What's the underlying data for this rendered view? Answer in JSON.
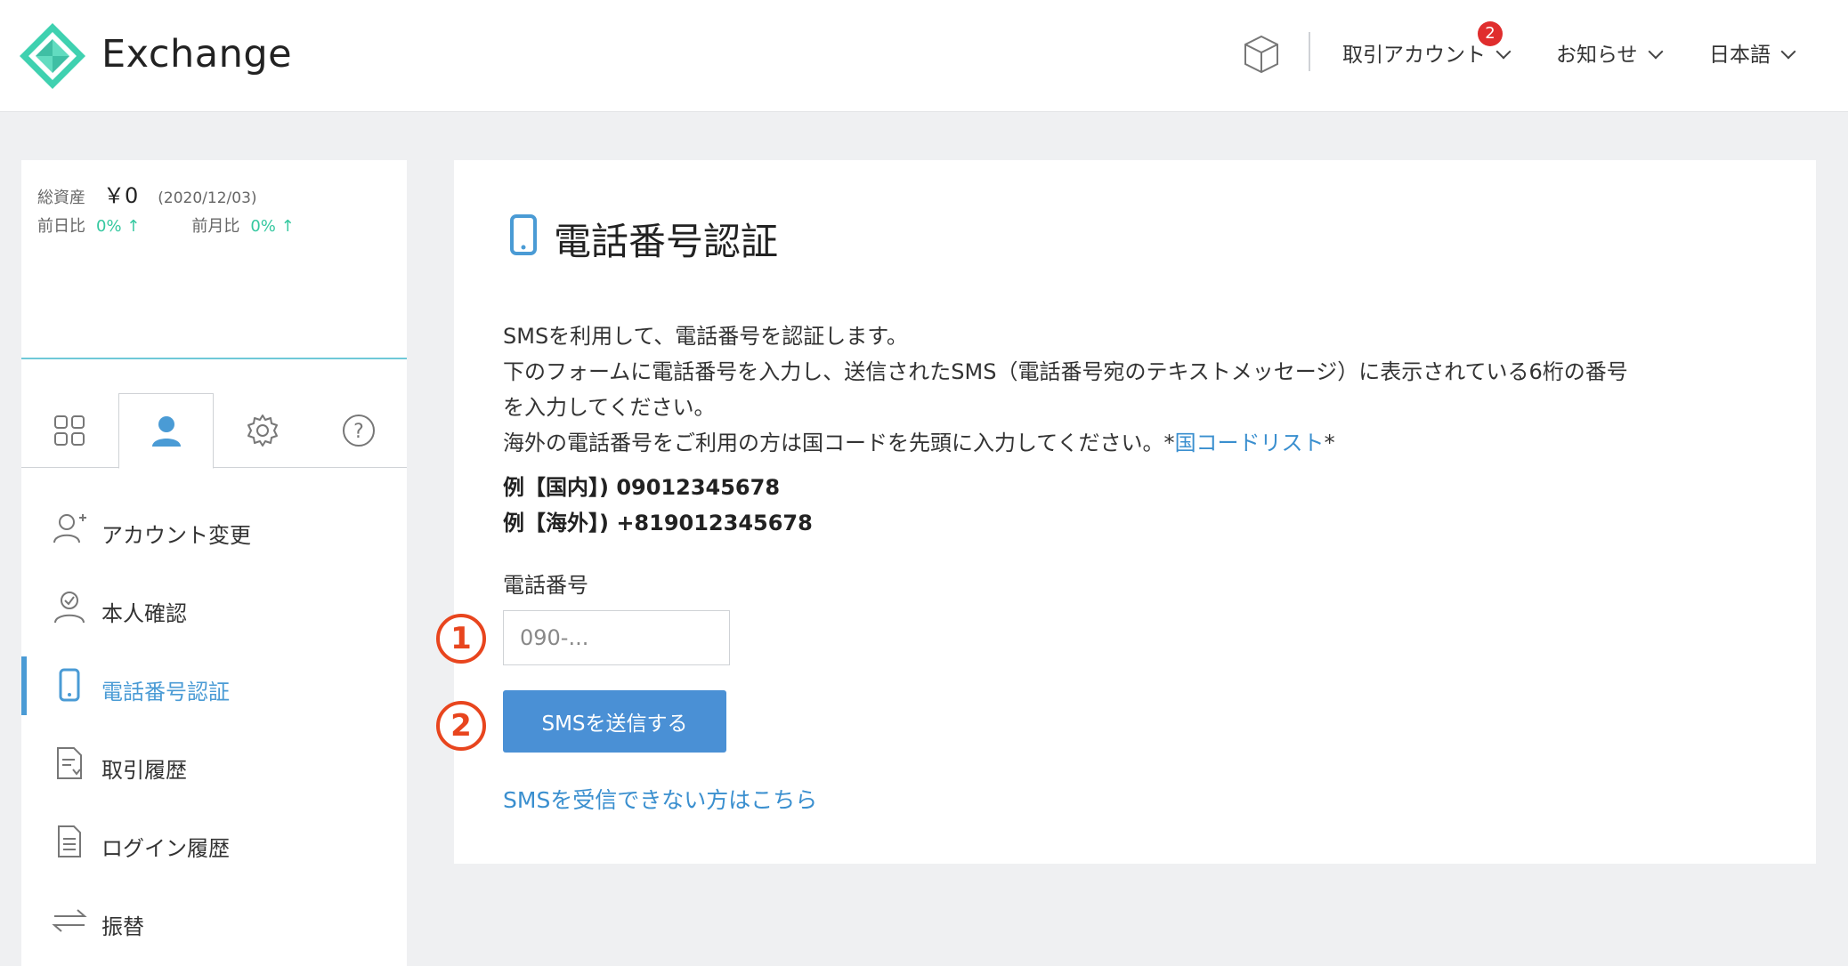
{
  "header": {
    "brand": "Exchange",
    "nav": {
      "account_label": "取引アカウント",
      "account_badge": "2",
      "news_label": "お知らせ",
      "lang_label": "日本語"
    }
  },
  "sidebar": {
    "assets": {
      "total_label": "総資産",
      "total_value": "￥0",
      "date": "(2020/12/03)",
      "day_label": "前日比",
      "day_value": "0% ↑",
      "month_label": "前月比",
      "month_value": "0% ↑"
    },
    "menu": [
      {
        "label": "アカウント変更",
        "icon": "user-add-icon"
      },
      {
        "label": "本人確認",
        "icon": "user-check-icon"
      },
      {
        "label": "電話番号認証",
        "icon": "phone-icon",
        "active": true
      },
      {
        "label": "取引履歴",
        "icon": "download-document-icon"
      },
      {
        "label": "ログイン履歴",
        "icon": "document-icon"
      },
      {
        "label": "振替",
        "icon": "transfer-arrows-icon"
      }
    ]
  },
  "main": {
    "title": "電話番号認証",
    "desc_lines": [
      "SMSを利用して、電話番号を認証します。",
      "下のフォームに電話番号を入力し、送信されたSMS（電話番号宛のテキストメッセージ）に表示されている6桁の番号",
      "を入力してください。",
      "海外の電話番号をご利用の方は国コードを先頭に入力してください。*"
    ],
    "country_code_link": "国コードリスト",
    "country_code_suffix": "*",
    "example_domestic": "例【国内】) 09012345678",
    "example_overseas": "例【海外】) +819012345678",
    "field_label": "電話番号",
    "phone_placeholder": "090-...",
    "send_button": "SMSを送信する",
    "help_link": "SMSを受信できない方はこちら",
    "step_markers": [
      "1",
      "2"
    ]
  },
  "colors": {
    "accent": "#4a90d5",
    "link": "#3a8fcf",
    "positive": "#35c8a0",
    "badge": "#e02d2d",
    "step_marker": "#e8451e"
  }
}
